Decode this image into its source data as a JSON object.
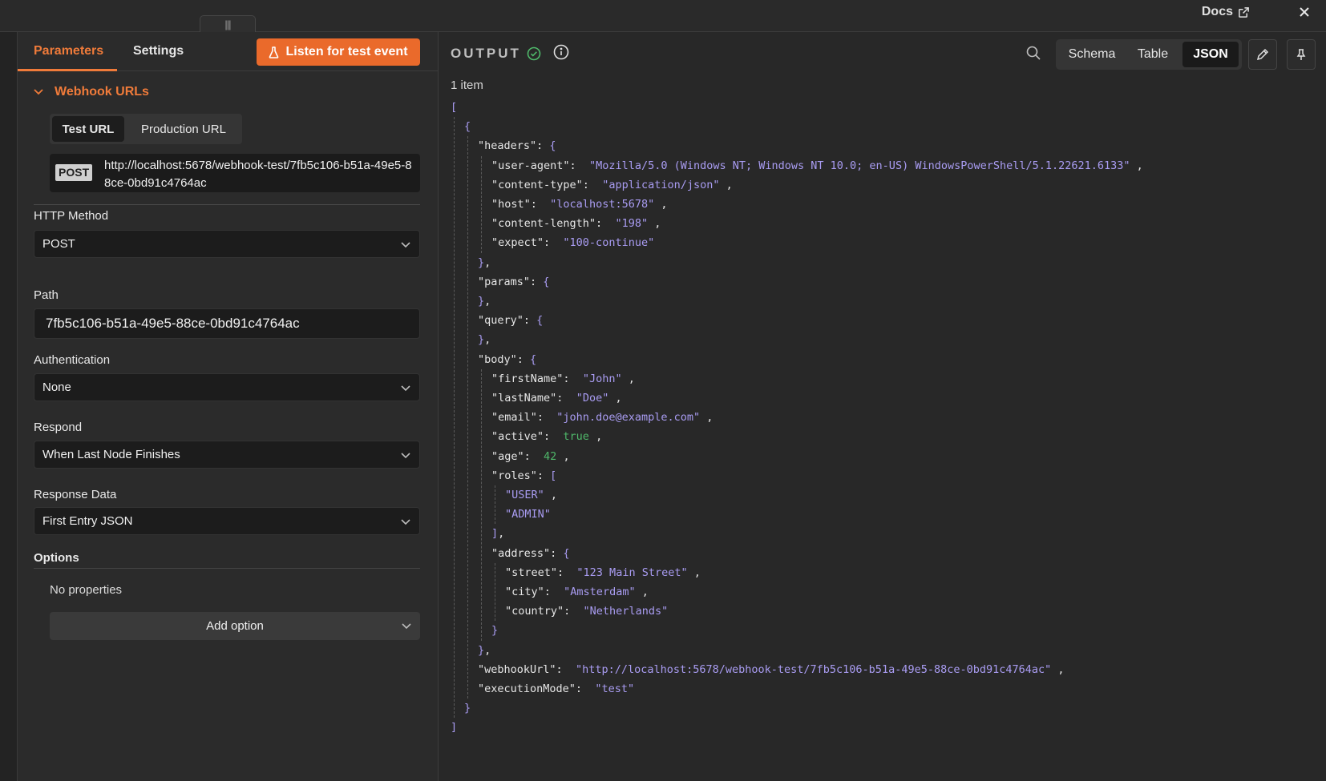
{
  "topbar": {
    "docs_label": "Docs",
    "handle": "|||"
  },
  "left": {
    "tabs": [
      "Parameters",
      "Settings"
    ],
    "listen_button": "Listen for test event",
    "webhook": {
      "section_title": "Webhook URLs",
      "url_tabs": [
        "Test URL",
        "Production URL"
      ],
      "method_badge": "POST",
      "url": "http://localhost:5678/webhook-test/7fb5c106-b51a-49e5-88ce-0bd91c4764ac"
    },
    "http_method": {
      "label": "HTTP Method",
      "value": "POST"
    },
    "path": {
      "label": "Path",
      "value": "7fb5c106-b51a-49e5-88ce-0bd91c4764ac"
    },
    "authentication": {
      "label": "Authentication",
      "value": "None"
    },
    "respond": {
      "label": "Respond",
      "value": "When Last Node Finishes"
    },
    "response_data": {
      "label": "Response Data",
      "value": "First Entry JSON"
    },
    "options": {
      "label": "Options",
      "empty_text": "No properties",
      "add_button": "Add option"
    }
  },
  "output": {
    "title": "OUTPUT",
    "count": "1 item",
    "views": [
      "Schema",
      "Table",
      "JSON"
    ],
    "active_view": "JSON",
    "json": {
      "headers": {
        "user-agent": "Mozilla/5.0 (Windows NT; Windows NT 10.0; en-US) WindowsPowerShell/5.1.22621.6133",
        "content-type": "application/json",
        "host": "localhost:5678",
        "content-length": "198",
        "expect": "100-continue"
      },
      "params": {},
      "query": {},
      "body": {
        "firstName": "John",
        "lastName": "Doe",
        "email": "john.doe@example.com",
        "active": true,
        "age": 42,
        "roles": [
          "USER",
          "ADMIN"
        ],
        "address": {
          "street": "123 Main Street",
          "city": "Amsterdam",
          "country": "Netherlands"
        }
      },
      "webhookUrl": "http://localhost:5678/webhook-test/7fb5c106-b51a-49e5-88ce-0bd91c4764ac",
      "executionMode": "test"
    }
  },
  "colors": {
    "accent": "#ea6a2b",
    "json_string": "#a99cf2",
    "json_bool": "#4fb86a"
  }
}
